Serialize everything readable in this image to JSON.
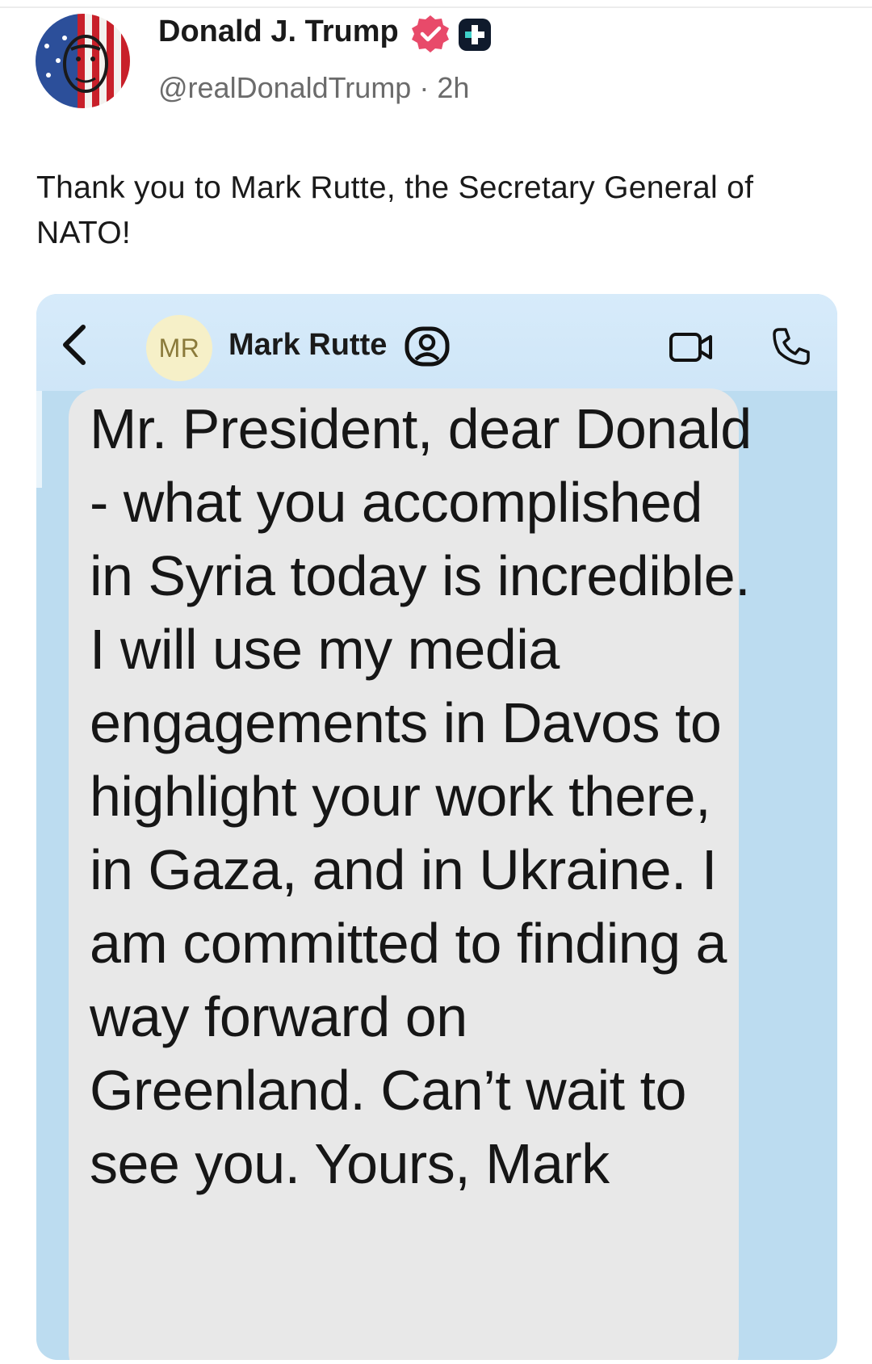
{
  "post": {
    "author_name": "Donald J. Trump",
    "handle_line": "@realDonaldTrump · 2h",
    "text": "Thank you to Mark Rutte, the Secretary General of NATO!",
    "icons": {
      "avatar": "profile-photo",
      "verified": "verified-badge-icon",
      "plus": "plus-badge-icon"
    },
    "colors": {
      "verified": "#e84a6a",
      "handle": "#6b6b6b"
    }
  },
  "chat": {
    "contact_initials": "MR",
    "contact_name": "Mark Rutte",
    "icons": {
      "back": "chevron-left-icon",
      "contact": "contact-info-icon",
      "video": "video-camera-icon",
      "phone": "phone-icon"
    },
    "message": "Mr. President, dear Donald - what you accomplished in Syria today is incredible. I will use my media engagements in Davos to highlight your work there, in Gaza, and in Ukraine. I am committed to finding a way forward on Greenland. Can’t wait to see you. Yours, Mark",
    "colors": {
      "header": "#d7ebfa",
      "background": "#bcdcf0",
      "bubble": "#e8e8e8",
      "contact_avatar": "#f6f0c8"
    }
  }
}
